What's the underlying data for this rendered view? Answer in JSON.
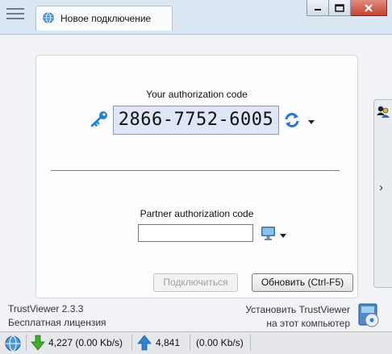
{
  "window": {
    "tab_title": "Новое подключение",
    "controls": [
      "minimize",
      "maximize",
      "close"
    ]
  },
  "connect": {
    "your_code_label": "Your authorization code",
    "your_code": "2866-7752-6005",
    "partner_label": "Partner authorization code",
    "partner_value": "",
    "connect_button": "Подключиться",
    "refresh_button": "Обновить (Ctrl-F5)"
  },
  "footer": {
    "app_name": "TrustViewer 2.3.3",
    "license": "Бесплатная лицензия",
    "install_line1": "Установить TrustViewer",
    "install_line2": "на этот компьютер"
  },
  "status": {
    "download": "4,227 (0.00 Kb/s)",
    "upload": "4,841",
    "upload_rate": "(0.00 Kb/s)"
  },
  "colors": {
    "titlebar": "#dbe6f3",
    "code_box": "#dfe6f6",
    "close_button": "#c4422f"
  },
  "icons": [
    "menu-icon",
    "globe-icon",
    "key-icon",
    "refresh-icon",
    "monitor-icon",
    "users-icon",
    "chevron-right-icon",
    "install-icon",
    "download-arrow-icon",
    "upload-arrow-icon"
  ]
}
